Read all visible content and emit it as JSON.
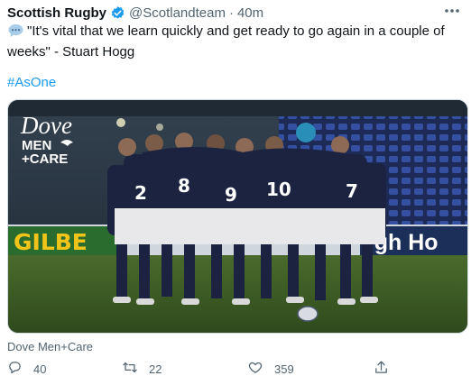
{
  "tweet": {
    "author_name": "Scottish Rugby",
    "handle": "@Scotlandteam",
    "separator": "·",
    "time": "40m",
    "text": "\"It's vital that we learn quickly and get ready to go again in a couple of weeks\" - Stuart Hogg",
    "hashtag": "#AsOne",
    "media": {
      "logo_word": "Dove",
      "logo_line1": "MEN",
      "logo_line2": "+CARE",
      "board_left": "GILBE",
      "board_right": "rgh Ho",
      "jersey_numbers": [
        "2",
        "8",
        "9",
        "10",
        "7"
      ]
    },
    "promoted_by": "Dove Men+Care",
    "counts": {
      "replies": "40",
      "retweets": "22",
      "likes": "359"
    }
  },
  "colors": {
    "accent": "#1d9bf0",
    "secondary_text": "#536471",
    "navy_kit": "#1b2340"
  }
}
